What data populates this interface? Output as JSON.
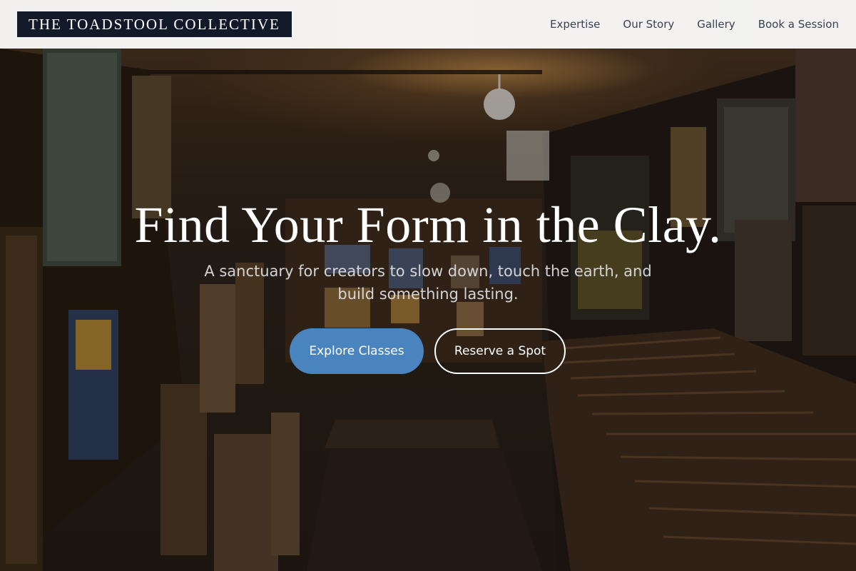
{
  "header": {
    "logo": "THE TOADSTOOL COLLECTIVE",
    "nav": [
      "Expertise",
      "Our Story",
      "Gallery",
      "Book a Session"
    ]
  },
  "hero": {
    "title": "Find Your Form in the Clay.",
    "subtitle": "A sanctuary for creators to slow down, touch the earth, and build something lasting.",
    "primary_button": "Explore Classes",
    "secondary_button": "Reserve a Spot"
  },
  "colors": {
    "logo_bg": "#121a2a",
    "primary_button": "#4a84bf",
    "nav_text": "#3b4150"
  }
}
